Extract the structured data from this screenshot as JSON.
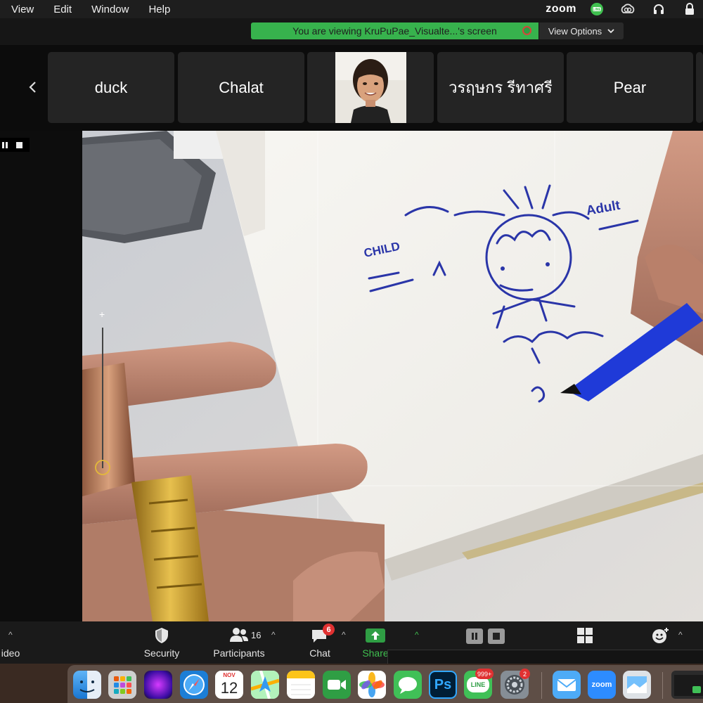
{
  "menubar": {
    "items": [
      "View",
      "Edit",
      "Window",
      "Help"
    ],
    "status_app": "zoom"
  },
  "share_banner": {
    "text": "You are viewing KruPuPae_Visualte...'s screen",
    "view_options_label": "View Options"
  },
  "participants": [
    {
      "name": "duck",
      "has_video": false
    },
    {
      "name": "Chalat",
      "has_video": false
    },
    {
      "name": "",
      "has_video": true
    },
    {
      "name": "วรฤษกร รีทาศรี",
      "has_video": false
    },
    {
      "name": "Pear",
      "has_video": false
    }
  ],
  "drawing_text": {
    "child_label": "CHILD",
    "adult_label": "Adult"
  },
  "toolbar": {
    "video_label": "ideo",
    "security_label": "Security",
    "participants_label": "Participants",
    "participants_count": "16",
    "chat_label": "Chat",
    "chat_badge": "6",
    "share_label": "Share"
  },
  "dock": {
    "calendar_month": "NOV",
    "calendar_day": "12",
    "line_badge": "999+",
    "settings_badge": "2",
    "ps_label": "Ps",
    "line_label": "LINE",
    "zoom_label": "zoom"
  },
  "colors": {
    "banner_green": "#37b24d",
    "toolbar_bg": "#1a1a1a",
    "tile_bg": "#242424",
    "share_green": "#2f9e44",
    "badge_red": "#e03131",
    "ink_blue": "#2a35a8"
  }
}
